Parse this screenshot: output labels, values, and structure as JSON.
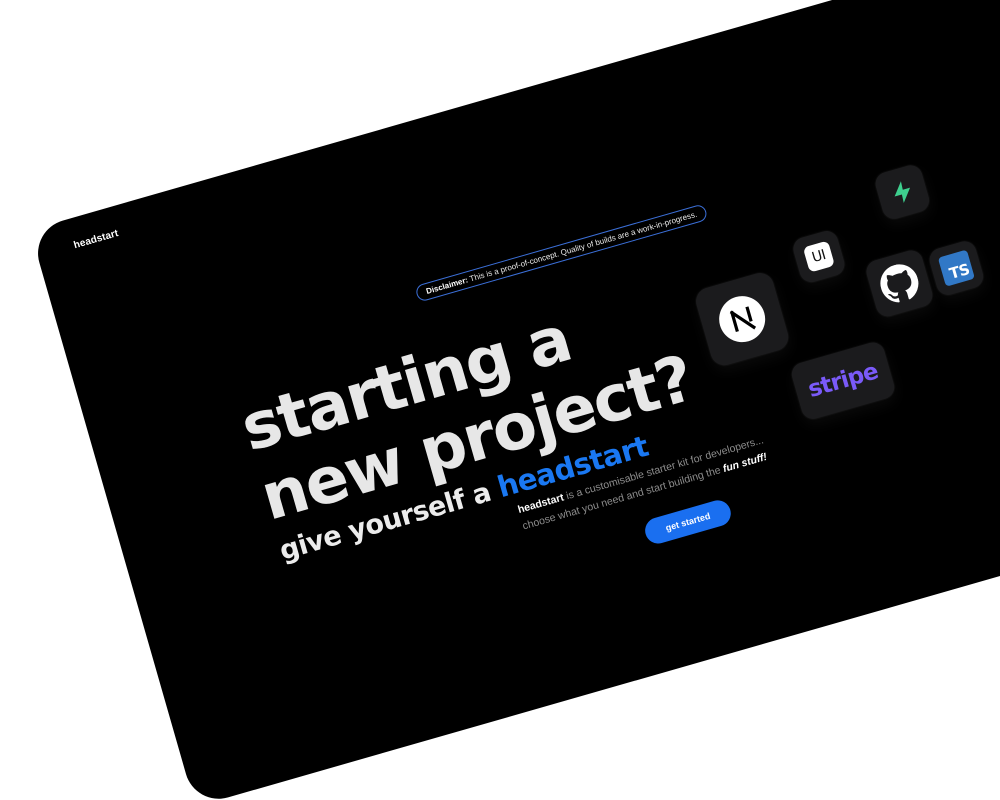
{
  "brand": "headstart",
  "disclaimer": {
    "label": "Disclaimer:",
    "text": "This is a proof-of-concept. Quality of builds are a work-in-progress."
  },
  "hero": {
    "line1": "starting a",
    "line2": "new project?",
    "sub_prefix": "give yourself a",
    "sub_accent": "headstart"
  },
  "description": {
    "brand": "headstart",
    "line1_rest": " is a customisable starter kit for developers...",
    "line2_prefix": "choose what you need and start building the ",
    "line2_emphasis": "fun stuff!"
  },
  "cta": {
    "label": "get started"
  },
  "tiles": {
    "nextjs": {
      "icon": "nextjs-logo-icon"
    },
    "shadcn_ui": {
      "icon": "ui-icon",
      "label": "UI"
    },
    "github": {
      "icon": "github-icon"
    },
    "supabase": {
      "icon": "supabase-bolt-icon"
    },
    "typescript": {
      "icon": "typescript-icon",
      "label": "TS"
    },
    "stripe": {
      "icon": "stripe-logo",
      "label": "stripe"
    }
  },
  "colors": {
    "background": "#000000",
    "accent": "#1a78f2",
    "stripe": "#7a5af8",
    "supabase": "#3ecf8e",
    "typescript": "#3178c6"
  }
}
